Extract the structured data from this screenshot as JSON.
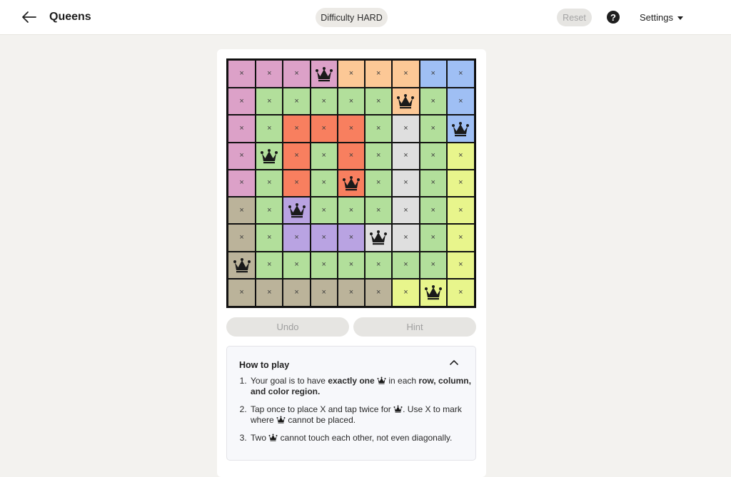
{
  "header": {
    "title": "Queens",
    "difficulty_label": "Difficulty",
    "difficulty_value": "HARD",
    "reset_label": "Reset",
    "help_label": "?",
    "settings_label": "Settings"
  },
  "board": {
    "size": 9,
    "region_colors": {
      "P": "#dca1c8",
      "O": "#fcc896",
      "B": "#9fbff4",
      "G": "#b2df9b",
      "R": "#f87f5f",
      "W": "#dfdfdf",
      "Y": "#e8f58c",
      "T": "#bbb39a",
      "V": "#b9a3e2"
    },
    "regions": [
      "PPPPOOOBB",
      "PGGGGGOGB",
      "PGRRRGWGB",
      "PGRGRGWGY",
      "PGRGRGWGY",
      "TGVGGGWGY",
      "TGVVVWWGY",
      "TGGGGGGGY",
      "TTTTTTYYY"
    ],
    "cells": [
      "xxxQxxxxx",
      "xxxxxxQxx",
      "xxxxxxxxQ",
      "xQxxxxxxx",
      "xxxxQxxxx",
      "xxQxxxxxx",
      "xxxxxQxxx",
      "Qxxxxxxxx",
      "xxxxxxxQx"
    ],
    "x_mark": "×"
  },
  "controls": {
    "undo_label": "Undo",
    "hint_label": "Hint"
  },
  "how_to_play": {
    "title": "How to play",
    "rule1": {
      "a": "Your goal is to have ",
      "b": "exactly one",
      "c": " in each ",
      "d": "row, column, and color region."
    },
    "rule2": {
      "a": "Tap once to place X and tap twice for ",
      "b": ". Use X to mark where ",
      "c": " cannot be placed."
    },
    "rule3": {
      "a": "Two ",
      "b": " cannot touch each other, not even diagonally."
    }
  }
}
